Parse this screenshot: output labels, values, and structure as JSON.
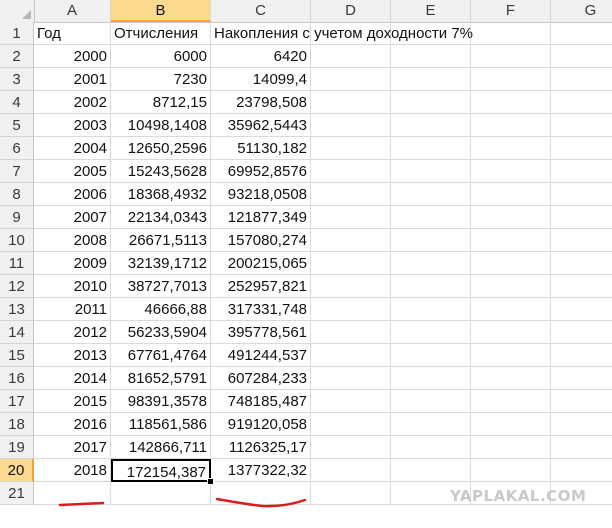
{
  "columns": [
    "A",
    "B",
    "C",
    "D",
    "E",
    "F",
    "G"
  ],
  "rows": [
    "1",
    "2",
    "3",
    "4",
    "5",
    "6",
    "7",
    "8",
    "9",
    "10",
    "11",
    "12",
    "13",
    "14",
    "15",
    "16",
    "17",
    "18",
    "19",
    "20",
    "21"
  ],
  "headers": {
    "a": "Год",
    "b": "Отчисления",
    "c": "Накопления с учетом доходности 7%"
  },
  "table": [
    {
      "year": "2000",
      "contrib": "6000",
      "accum": "6420"
    },
    {
      "year": "2001",
      "contrib": "7230",
      "accum": "14099,4"
    },
    {
      "year": "2002",
      "contrib": "8712,15",
      "accum": "23798,508"
    },
    {
      "year": "2003",
      "contrib": "10498,1408",
      "accum": "35962,5443"
    },
    {
      "year": "2004",
      "contrib": "12650,2596",
      "accum": "51130,182"
    },
    {
      "year": "2005",
      "contrib": "15243,5628",
      "accum": "69952,8576"
    },
    {
      "year": "2006",
      "contrib": "18368,4932",
      "accum": "93218,0508"
    },
    {
      "year": "2007",
      "contrib": "22134,0343",
      "accum": "121877,349"
    },
    {
      "year": "2008",
      "contrib": "26671,5113",
      "accum": "157080,274"
    },
    {
      "year": "2009",
      "contrib": "32139,1712",
      "accum": "200215,065"
    },
    {
      "year": "2010",
      "contrib": "38727,7013",
      "accum": "252957,821"
    },
    {
      "year": "2011",
      "contrib": "46666,88",
      "accum": "317331,748"
    },
    {
      "year": "2012",
      "contrib": "56233,5904",
      "accum": "395778,561"
    },
    {
      "year": "2013",
      "contrib": "67761,4764",
      "accum": "491244,537"
    },
    {
      "year": "2014",
      "contrib": "81652,5791",
      "accum": "607284,233"
    },
    {
      "year": "2015",
      "contrib": "98391,3578",
      "accum": "748185,487"
    },
    {
      "year": "2016",
      "contrib": "118561,586",
      "accum": "919120,058"
    },
    {
      "year": "2017",
      "contrib": "142866,711",
      "accum": "1126325,17"
    },
    {
      "year": "2018",
      "contrib": "172154,387",
      "accum": "1377322,32"
    }
  ],
  "selection": {
    "column": "B",
    "row": "20"
  },
  "watermark": "YAPLAKAL.COM",
  "colors": {
    "selected_header": "#fbd98e",
    "selected_accent": "#f2a33a",
    "annotation": "#d81e1e"
  }
}
